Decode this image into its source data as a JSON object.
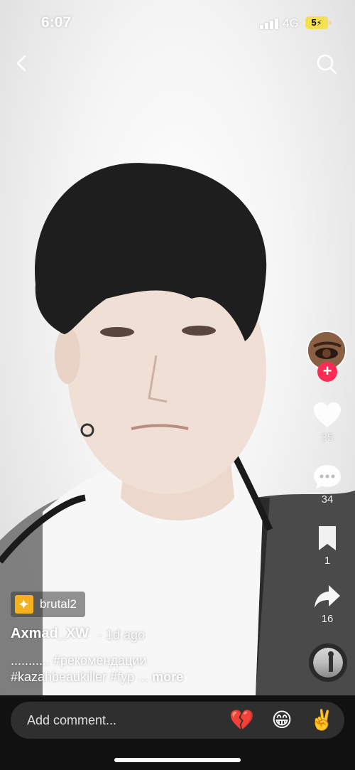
{
  "status_bar": {
    "time": "6:07",
    "network": "4G",
    "battery": "5"
  },
  "video": {
    "description_icons": [
      "back-icon",
      "search-icon"
    ]
  },
  "rail": {
    "likes": "35",
    "comments": "34",
    "saves": "1",
    "shares": "16"
  },
  "effect": {
    "label": "brutal2"
  },
  "author": {
    "name": "Axmad_XW",
    "time": "· 1d ago"
  },
  "caption": {
    "line1": "........... #рекомендации",
    "line2": "#kazahbeaukiller #fyp ... ",
    "more": "more"
  },
  "comment_bar": {
    "placeholder": "Add comment...",
    "emojis": [
      "💔",
      "😁",
      "✌️"
    ]
  },
  "colors": {
    "follow": "#fe2c55",
    "battery": "#f5e052",
    "effect": "#f6b21c"
  }
}
